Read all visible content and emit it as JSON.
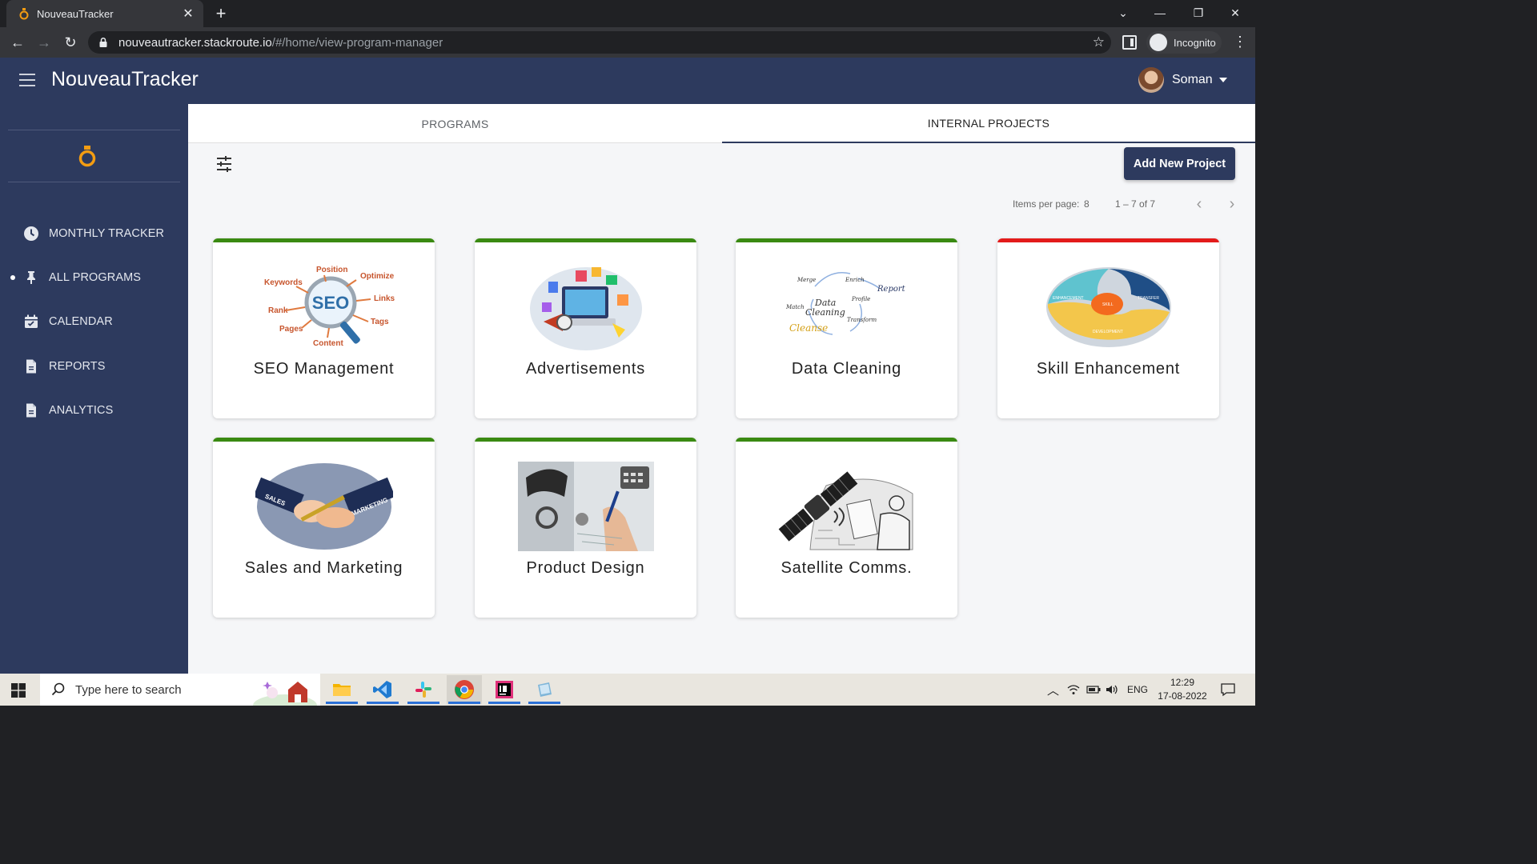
{
  "browser": {
    "tab_title": "NouveauTracker",
    "url_host": "nouveautracker.stackroute.io",
    "url_path": "/#/home/view-program-manager",
    "profile_label": "Incognito"
  },
  "app": {
    "title": "NouveauTracker",
    "user_name": "Soman"
  },
  "sidebar": {
    "items": [
      {
        "label": "MONTHLY TRACKER",
        "icon": "clock-icon"
      },
      {
        "label": "ALL PROGRAMS",
        "icon": "pin-icon",
        "active": true
      },
      {
        "label": "CALENDAR",
        "icon": "calendar-icon"
      },
      {
        "label": "REPORTS",
        "icon": "document-icon"
      },
      {
        "label": "ANALYTICS",
        "icon": "document-icon"
      }
    ]
  },
  "tabs": [
    {
      "label": "PROGRAMS",
      "active": false
    },
    {
      "label": "INTERNAL PROJECTS",
      "active": true
    }
  ],
  "toolbar": {
    "add_label": "Add New Project"
  },
  "paginator": {
    "items_per_page_label": "Items per page:",
    "items_per_page_value": "8",
    "range_label": "1 – 7 of 7"
  },
  "projects": [
    {
      "name": "SEO Management",
      "status_color": "#3a8a12",
      "image": "seo-illustration"
    },
    {
      "name": "Advertisements",
      "status_color": "#3a8a12",
      "image": "advertisement-illustration"
    },
    {
      "name": "Data Cleaning",
      "status_color": "#3a8a12",
      "image": "data-cleaning-illustration"
    },
    {
      "name": "Skill Enhancement",
      "status_color": "#e31b1b",
      "image": "skill-cycle-illustration"
    },
    {
      "name": "Sales and Marketing",
      "status_color": "#3a8a12",
      "image": "handshake-illustration"
    },
    {
      "name": "Product Design",
      "status_color": "#3a8a12",
      "image": "design-photo"
    },
    {
      "name": "Satellite Comms.",
      "status_color": "#3a8a12",
      "image": "satellite-illustration"
    }
  ],
  "illustration_text": {
    "seo": {
      "center": "SEO",
      "words": [
        "Position",
        "Optimize",
        "Keywords",
        "Links",
        "Rank",
        "Tags",
        "Pages",
        "Content"
      ]
    },
    "data_cleaning": {
      "words": [
        "Merge",
        "Enrich",
        "Report",
        "Profile",
        "Match",
        "Data",
        "Cleaning",
        "Transform",
        "Cleanse"
      ]
    },
    "skill": {
      "words": [
        "ENHANCEMENT",
        "TRANSFER",
        "SKILL",
        "DEVELOPMENT"
      ]
    },
    "sales": {
      "words": [
        "SALES",
        "MARKETING"
      ]
    }
  },
  "taskbar": {
    "search_placeholder": "Type here to search",
    "language": "ENG",
    "time": "12:29",
    "date": "17-08-2022"
  }
}
